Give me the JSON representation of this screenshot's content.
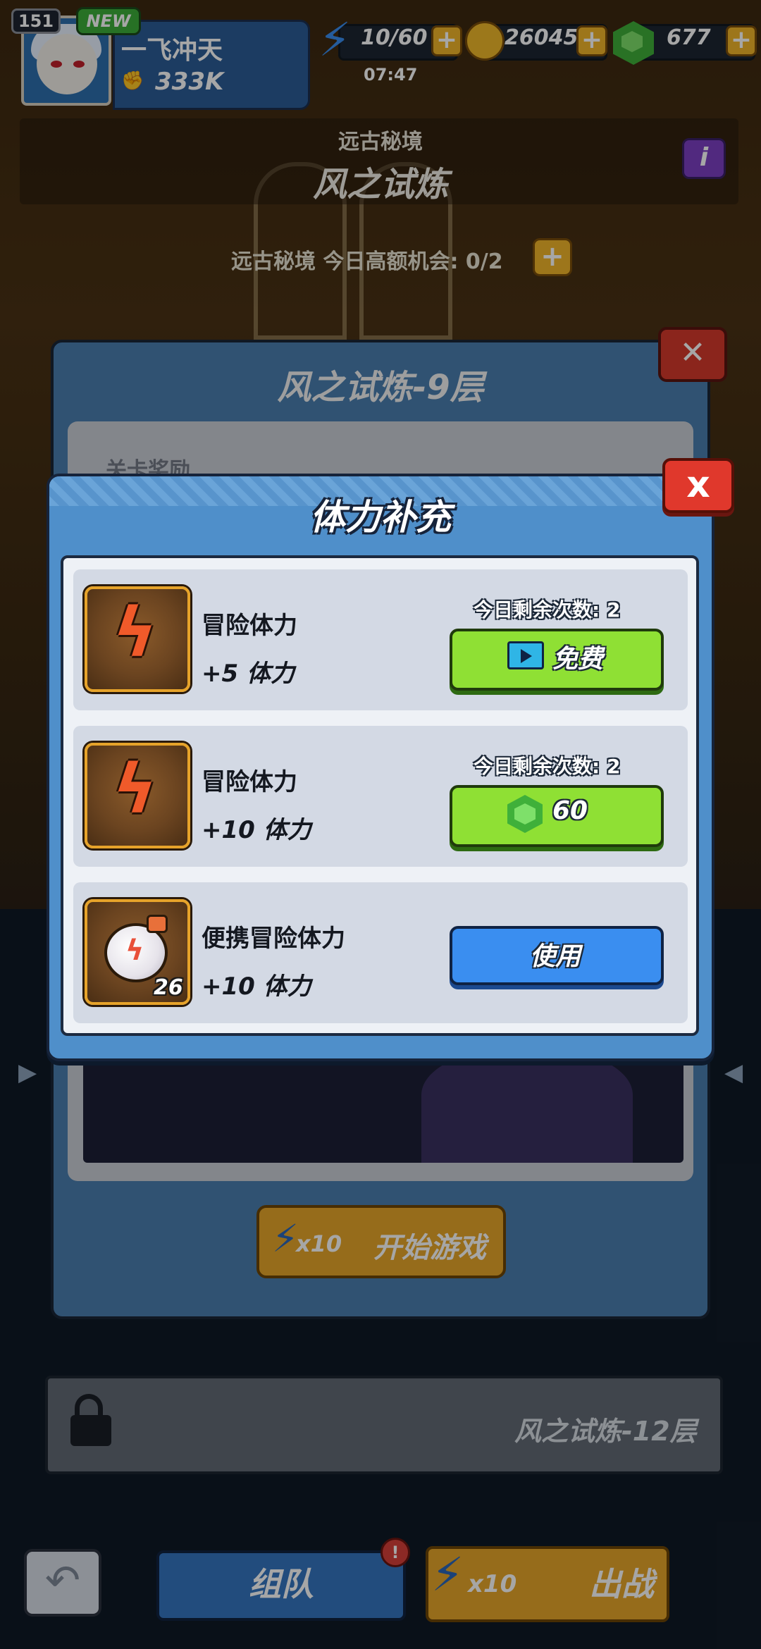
{
  "hud": {
    "level": "151",
    "new_badge": "NEW",
    "player_name": "一飞冲天",
    "power": "333K",
    "stamina": "10/60",
    "coins": "26045",
    "gems": "677",
    "timer": "07:47",
    "plus": "+"
  },
  "realm": {
    "subtitle": "远古秘境",
    "title": "风之试炼",
    "info": "i",
    "chance_text": "远古秘境 今日高额机会: 0/2"
  },
  "stage": {
    "title": "风之试炼-9层",
    "reward_label": "关卡奖励",
    "start_cost": "x10",
    "start_label": "开始游戏",
    "locked_name": "风之试炼-12层"
  },
  "bottom": {
    "team_label": "组队",
    "fight_cost": "x10",
    "fight_label": "出战"
  },
  "modal": {
    "title": "体力补充",
    "close": "x",
    "rows": [
      {
        "name": "冒险体力",
        "gain": "+5 体力",
        "remaining": "今日剩余次数: 2",
        "button_label": "免费",
        "button_icon": "video-icon"
      },
      {
        "name": "冒险体力",
        "gain": "+10 体力",
        "remaining": "今日剩余次数: 2",
        "button_label": "60",
        "button_icon": "gem-icon"
      },
      {
        "name": "便携冒险体力",
        "gain": "+10 体力",
        "count": "26",
        "button_label": "使用"
      }
    ]
  },
  "colors": {
    "modal_blue": "#4f8fca",
    "green_button": "#8fe034",
    "blue_button": "#3a8ef0",
    "close_red": "#e0382c",
    "accent_gold": "#e6a32a"
  }
}
